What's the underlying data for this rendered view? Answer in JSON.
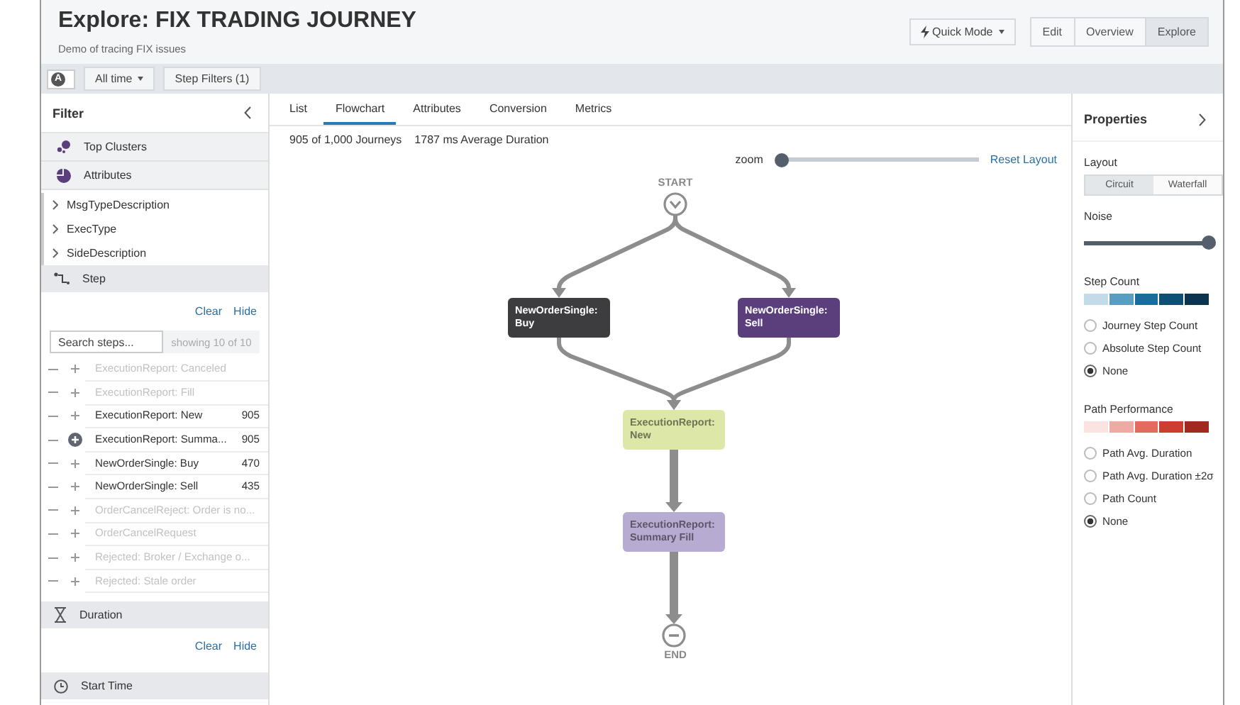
{
  "header": {
    "title": "Explore: FIX TRADING JOURNEY",
    "subtitle": "Demo of tracing FIX issues",
    "quick_mode": "Quick Mode",
    "modes": [
      {
        "label": "Edit",
        "selected": false
      },
      {
        "label": "Overview",
        "selected": false
      },
      {
        "label": "Explore",
        "selected": true
      }
    ]
  },
  "toolbar": {
    "toggle_label": "A",
    "toggle_on": true,
    "time_range": "All time",
    "step_filters": "Step Filters (1)"
  },
  "sidebar": {
    "title": "Filter",
    "sections": [
      {
        "label": "Top Clusters",
        "kind": "clusters"
      },
      {
        "label": "Attributes",
        "kind": "attributes"
      }
    ],
    "attributes": [
      "MsgTypeDescription",
      "ExecType",
      "SideDescription"
    ],
    "step": {
      "label": "Step",
      "clear": "Clear",
      "hide": "Hide",
      "placeholder": "Search steps...",
      "showing": "showing 10 of 10",
      "items": [
        {
          "label": "ExecutionReport: Canceled",
          "active": false,
          "included": false
        },
        {
          "label": "ExecutionReport: Fill",
          "active": false,
          "included": false
        },
        {
          "label": "ExecutionReport: New",
          "count": "905",
          "active": true,
          "included": false
        },
        {
          "label": "ExecutionReport: Summa...",
          "count": "905",
          "active": true,
          "included": true
        },
        {
          "label": "NewOrderSingle: Buy",
          "count": "470",
          "active": true,
          "included": false
        },
        {
          "label": "NewOrderSingle: Sell",
          "count": "435",
          "active": true,
          "included": false
        },
        {
          "label": "OrderCancelReject: Order is no...",
          "active": false,
          "included": false
        },
        {
          "label": "OrderCancelRequest",
          "active": false,
          "included": false
        },
        {
          "label": "Rejected: Broker / Exchange o...",
          "active": false,
          "included": false
        },
        {
          "label": "Rejected: Stale order",
          "active": false,
          "included": false
        }
      ]
    },
    "duration": {
      "label": "Duration",
      "clear": "Clear",
      "hide": "Hide"
    },
    "start_time": {
      "label": "Start Time"
    }
  },
  "tabs": [
    {
      "label": "List",
      "selected": false
    },
    {
      "label": "Flowchart",
      "selected": true
    },
    {
      "label": "Attributes",
      "selected": false
    },
    {
      "label": "Conversion",
      "selected": false
    },
    {
      "label": "Metrics",
      "selected": false
    }
  ],
  "summary": {
    "journeys": "905 of 1,000 Journeys",
    "duration": "1787 ms Average Duration"
  },
  "zoom": {
    "label": "zoom",
    "level": 0,
    "reset": "Reset Layout"
  },
  "flowchart": {
    "start": "START",
    "end": "END",
    "nodes": [
      {
        "label": "NewOrderSingle:",
        "sub": "Buy",
        "color": "#3d3d40",
        "kind": "dark"
      },
      {
        "label": "NewOrderSingle:",
        "sub": "Sell",
        "color": "#5b3e7c",
        "kind": "dark"
      },
      {
        "label": "ExecutionReport:",
        "sub": "New",
        "color": "#dde8a8",
        "kind": "light"
      },
      {
        "label": "ExecutionReport:",
        "sub": "Summary Fill",
        "color": "#b8abd1",
        "kind": "light"
      }
    ]
  },
  "properties": {
    "title": "Properties",
    "layout_label": "Layout",
    "layouts": [
      {
        "label": "Circuit",
        "selected": true
      },
      {
        "label": "Waterfall",
        "selected": false
      }
    ],
    "noise": {
      "label": "Noise",
      "level": 1
    },
    "step_count": {
      "label": "Step Count",
      "scale": [
        {
          "color": "#c3dbe8"
        },
        {
          "color": "#5b9dc2"
        },
        {
          "color": "#1a6d9b"
        },
        {
          "color": "#0f4f75"
        },
        {
          "color": "#0b3450"
        }
      ],
      "options": [
        {
          "label": "Journey Step Count",
          "selected": false
        },
        {
          "label": "Absolute Step Count",
          "selected": false
        },
        {
          "label": "None",
          "selected": true
        }
      ]
    },
    "path_performance": {
      "label": "Path Performance",
      "scale": [
        {
          "color": "#fbe3e1"
        },
        {
          "color": "#eeaaa3"
        },
        {
          "color": "#e26a5e"
        },
        {
          "color": "#cc3f30"
        },
        {
          "color": "#a12a20"
        }
      ],
      "options": [
        {
          "label": "Path Avg. Duration",
          "selected": false
        },
        {
          "label": "Path Avg. Duration ±2σ",
          "selected": false
        },
        {
          "label": "Path Count",
          "selected": false
        },
        {
          "label": "None",
          "selected": true
        }
      ]
    }
  }
}
